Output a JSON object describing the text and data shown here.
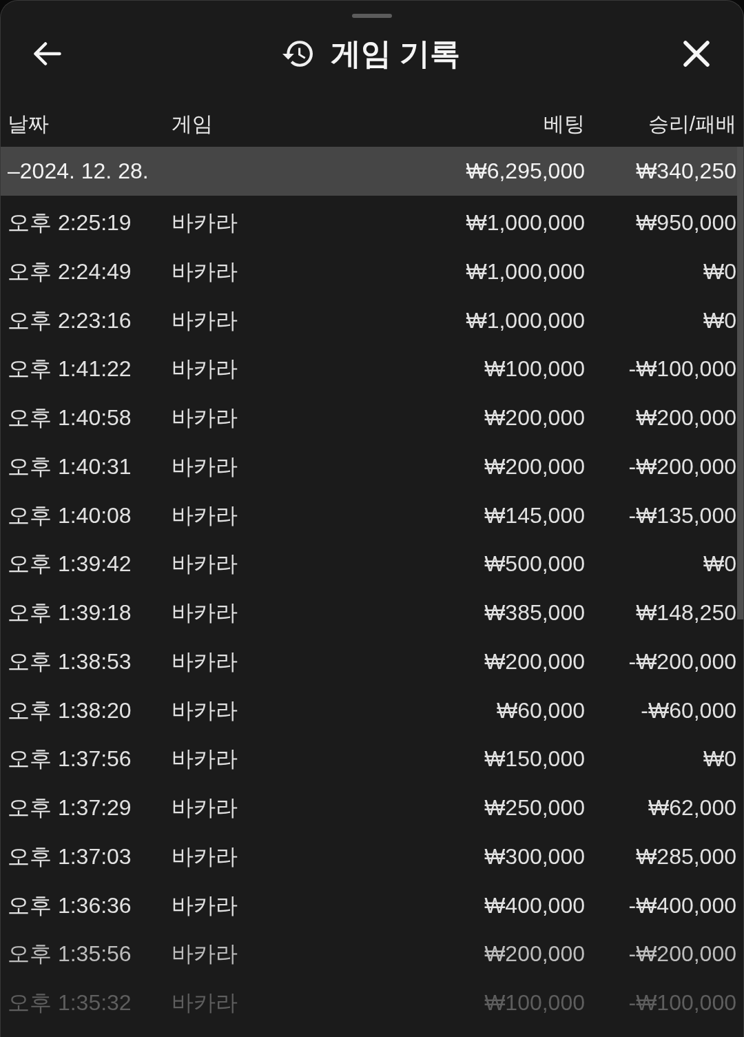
{
  "sheet": {
    "title": "게임 기록"
  },
  "table": {
    "columns": [
      "날짜",
      "게임",
      "베팅",
      "승리/패배"
    ],
    "group": {
      "label": "–2024. 12. 28.",
      "bet_total": "₩6,295,000",
      "result_total": "₩340,250"
    },
    "rows": [
      {
        "time": "오후 2:25:19",
        "game": "바카라",
        "bet": "₩1,000,000",
        "result": "₩950,000"
      },
      {
        "time": "오후 2:24:49",
        "game": "바카라",
        "bet": "₩1,000,000",
        "result": "₩0"
      },
      {
        "time": "오후 2:23:16",
        "game": "바카라",
        "bet": "₩1,000,000",
        "result": "₩0"
      },
      {
        "time": "오후 1:41:22",
        "game": "바카라",
        "bet": "₩100,000",
        "result": "-₩100,000"
      },
      {
        "time": "오후 1:40:58",
        "game": "바카라",
        "bet": "₩200,000",
        "result": "₩200,000"
      },
      {
        "time": "오후 1:40:31",
        "game": "바카라",
        "bet": "₩200,000",
        "result": "-₩200,000"
      },
      {
        "time": "오후 1:40:08",
        "game": "바카라",
        "bet": "₩145,000",
        "result": "-₩135,000"
      },
      {
        "time": "오후 1:39:42",
        "game": "바카라",
        "bet": "₩500,000",
        "result": "₩0"
      },
      {
        "time": "오후 1:39:18",
        "game": "바카라",
        "bet": "₩385,000",
        "result": "₩148,250"
      },
      {
        "time": "오후 1:38:53",
        "game": "바카라",
        "bet": "₩200,000",
        "result": "-₩200,000"
      },
      {
        "time": "오후 1:38:20",
        "game": "바카라",
        "bet": "₩60,000",
        "result": "-₩60,000"
      },
      {
        "time": "오후 1:37:56",
        "game": "바카라",
        "bet": "₩150,000",
        "result": "₩0"
      },
      {
        "time": "오후 1:37:29",
        "game": "바카라",
        "bet": "₩250,000",
        "result": "₩62,000"
      },
      {
        "time": "오후 1:37:03",
        "game": "바카라",
        "bet": "₩300,000",
        "result": "₩285,000"
      },
      {
        "time": "오후 1:36:36",
        "game": "바카라",
        "bet": "₩400,000",
        "result": "-₩400,000"
      },
      {
        "time": "오후 1:35:56",
        "game": "바카라",
        "bet": "₩200,000",
        "result": "-₩200,000"
      },
      {
        "time": "오후 1:35:32",
        "game": "바카라",
        "bet": "₩100,000",
        "result": "-₩100,000"
      }
    ]
  }
}
